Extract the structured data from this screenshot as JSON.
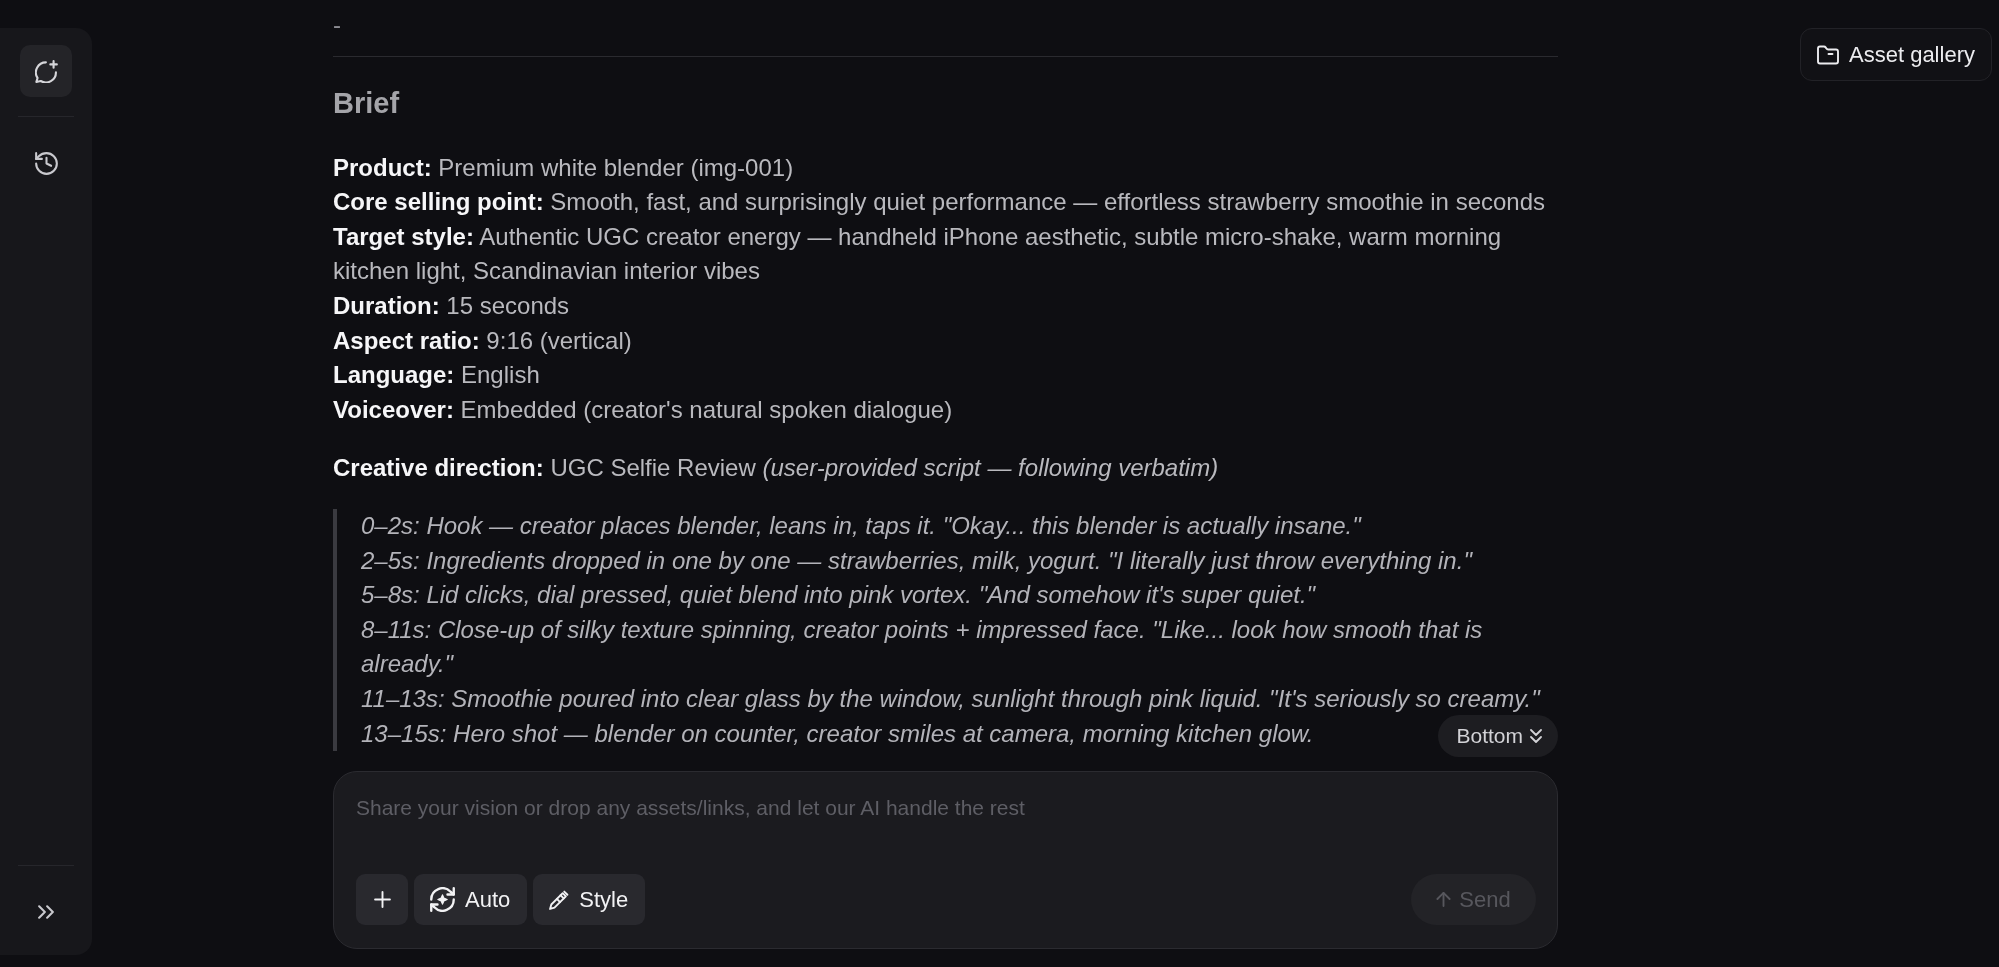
{
  "sidebar": {
    "items": [
      {
        "kind": "new_chat",
        "selected": true
      },
      {
        "kind": "history",
        "selected": false
      }
    ]
  },
  "header": {
    "asset_gallery_button": "Asset gallery"
  },
  "message": {
    "lead": "-",
    "heading": "Brief",
    "brief_lines": [
      "**Product:** Premium white blender (img-001)",
      "**Core selling point:** Smooth, fast, and surprisingly quiet performance — effortless strawberry smoothie in seconds",
      "**Target style:** Authentic UGC creator energy — handheld iPhone aesthetic, subtle micro-shake, warm morning kitchen light, Scandinavian interior vibes",
      "**Duration:** 15 seconds",
      "**Aspect ratio:** 9:16 (vertical)",
      "**Language:** English",
      "**Voiceover:** Embedded (creator's natural spoken dialogue)"
    ],
    "direction": "**Creative direction:** UGC Selfie Review *(user-provided script — following verbatim)*",
    "script": [
      "0–2s: Hook — creator places blender, leans in, taps it. \"Okay... this blender is actually insane.\"",
      "2–5s: Ingredients dropped in one by one — strawberries, milk, yogurt. \"I literally just throw everything in.\"",
      "5–8s: Lid clicks, dial pressed, quiet blend into pink vortex. \"And somehow it's super quiet.\"",
      "8–11s: Close-up of silky texture spinning, creator points + impressed face. \"Like... look how smooth that is already.\"",
      "11–13s: Smoothie poured into clear glass by the window, sunlight through pink liquid. \"It's seriously so creamy.\"",
      "13–15s: Hero shot — blender on counter, creator smiles at camera, morning kitchen glow."
    ]
  },
  "scroll_button": "Bottom",
  "composer": {
    "placeholder": "Share your vision or drop any assets/links, and let our AI handle the rest",
    "tools": [
      {
        "kind": "attach"
      },
      {
        "kind": "auto",
        "label": "Auto"
      },
      {
        "kind": "style",
        "label": "Style"
      }
    ],
    "send": {
      "label": "Send",
      "disabled": true
    }
  }
}
